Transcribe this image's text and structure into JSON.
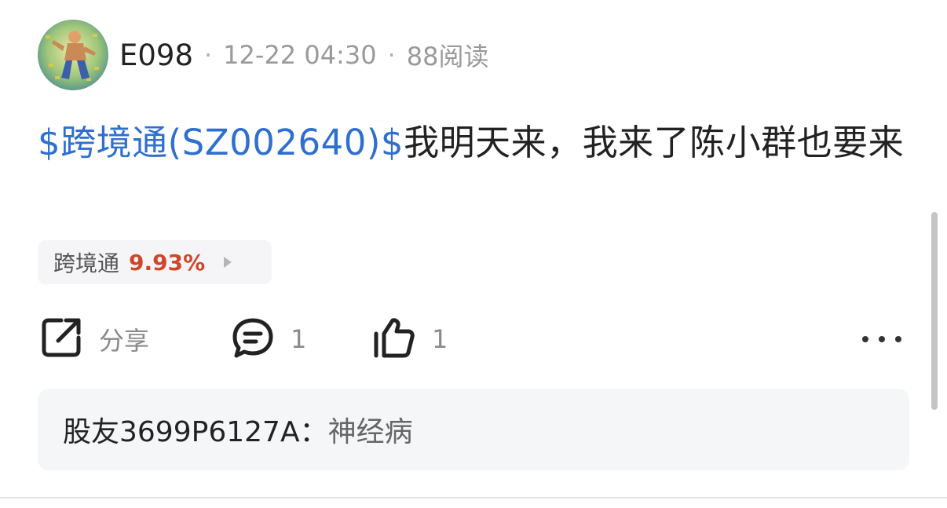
{
  "post": {
    "username": "E098",
    "date": "12-22 04:30",
    "reads": "88阅读",
    "stock_link": "$跨境通(SZ002640)$",
    "text": "我明天来，我来了陈小群也要来",
    "stock_chip": {
      "name": "跨境通",
      "change": "9.93%"
    }
  },
  "actions": {
    "share_label": "分享",
    "comment_count": "1",
    "like_count": "1"
  },
  "comment": {
    "user": "股友3699P6127A",
    "colon": "：",
    "text": "神经病"
  },
  "icons": [
    "avatar",
    "share-icon",
    "comment-icon",
    "thumbs-up-icon",
    "more-icon",
    "chevron-right-icon"
  ],
  "colors": {
    "link": "#2f6fd0",
    "rise": "#d0462a",
    "comment_bg": "#f5f6f8",
    "chip_bg": "#f5f5f7"
  }
}
